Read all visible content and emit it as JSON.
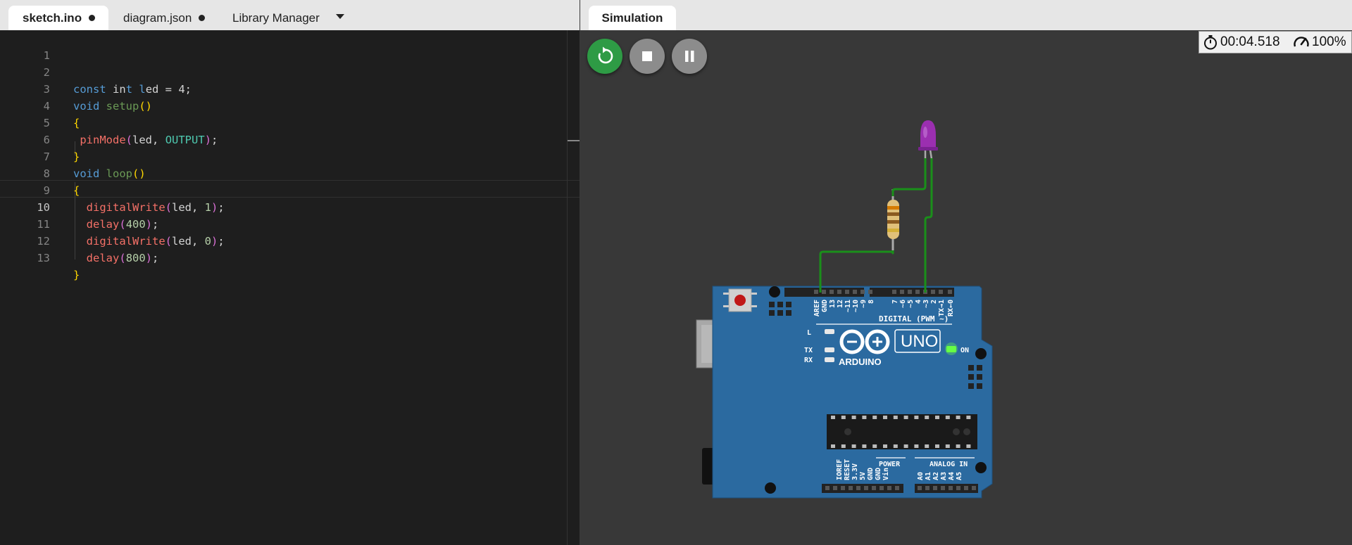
{
  "editor": {
    "tabs": [
      {
        "label": "sketch.ino",
        "modified": true,
        "active": true
      },
      {
        "label": "diagram.json",
        "modified": true,
        "active": false
      },
      {
        "label": "Library Manager",
        "modified": false,
        "active": false
      }
    ],
    "current_line": 10,
    "lines": [
      {
        "n": "1",
        "code": ""
      },
      {
        "n": "2",
        "code": "const int led = 4;"
      },
      {
        "n": "3",
        "code": "void setup()"
      },
      {
        "n": "4",
        "code": "{"
      },
      {
        "n": "5",
        "code": " pinMode(led, OUTPUT);"
      },
      {
        "n": "6",
        "code": "}"
      },
      {
        "n": "7",
        "code": "void loop()"
      },
      {
        "n": "8",
        "code": "{"
      },
      {
        "n": "9",
        "code": "  digitalWrite(led, 1);"
      },
      {
        "n": "10",
        "code": "  delay(400);"
      },
      {
        "n": "11",
        "code": "  digitalWrite(led, 0);"
      },
      {
        "n": "12",
        "code": "  delay(800);"
      },
      {
        "n": "13",
        "code": "}"
      }
    ]
  },
  "simulation": {
    "tab_label": "Simulation",
    "timer": "00:04.518",
    "speed": "100%",
    "icons": {
      "restart": "restart-icon",
      "stop": "stop-icon",
      "pause": "pause-icon",
      "timer": "stopwatch-icon",
      "speed": "speedometer-icon"
    }
  },
  "board": {
    "logo_text": "ARDUINO",
    "model": "UNO",
    "on_label": "ON",
    "l_label": "L",
    "tx_label": "TX",
    "rx_label": "RX",
    "digital_label": "DIGITAL (PWM ~)",
    "power_label": "POWER",
    "analog_label": "ANALOG IN",
    "top_pins": [
      "AREF",
      "GND",
      "13",
      "12",
      "~11",
      "~10",
      "~9",
      "8",
      "7",
      "~6",
      "~5",
      "4",
      "~3",
      "2",
      "TX→1",
      "RX←0"
    ],
    "bottom_pins": [
      "IOREF",
      "RESET",
      "3.3V",
      "5V",
      "GND",
      "GND",
      "Vin",
      "A0",
      "A1",
      "A2",
      "A3",
      "A4",
      "A5"
    ]
  },
  "colors": {
    "wire": "#1a8f1a",
    "board": "#2b6aa0",
    "led": "#9b2fb0",
    "power_led": "#66ff44",
    "play": "#2e9b45"
  }
}
